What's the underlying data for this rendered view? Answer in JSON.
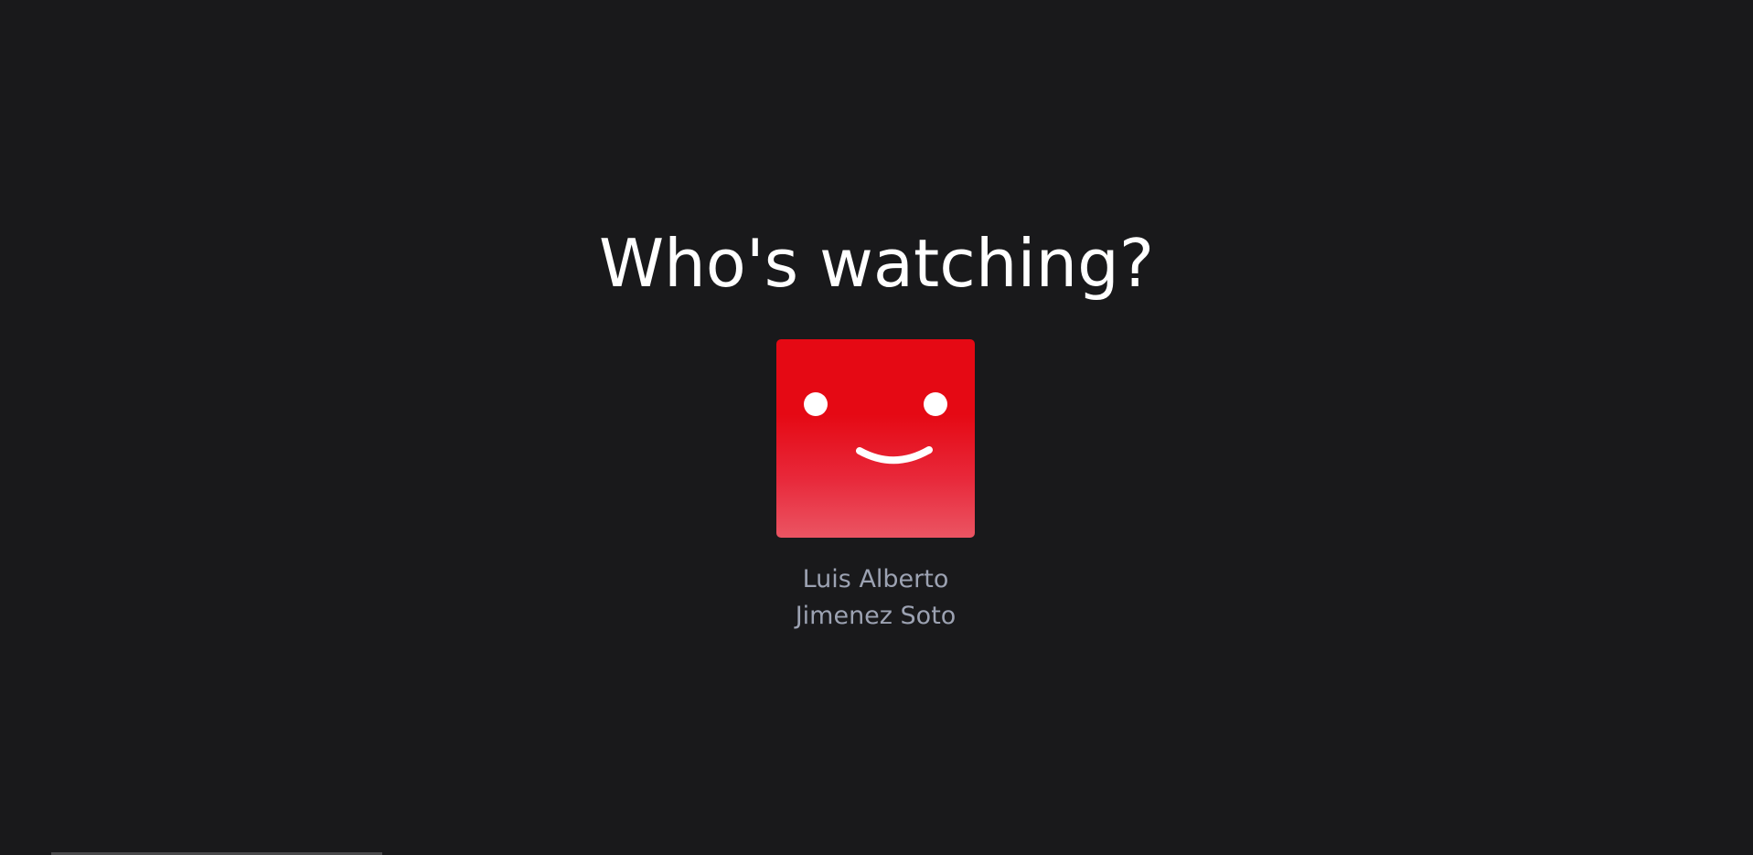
{
  "page": {
    "title": "Who's watching?"
  },
  "profiles": [
    {
      "name": "Luis Alberto Jimenez Soto",
      "avatar_icon": "smiley-face-icon",
      "avatar_color": "#e50914"
    }
  ],
  "colors": {
    "background": "#19191b",
    "title": "#ffffff",
    "profile_name": "#9ca2b2"
  }
}
